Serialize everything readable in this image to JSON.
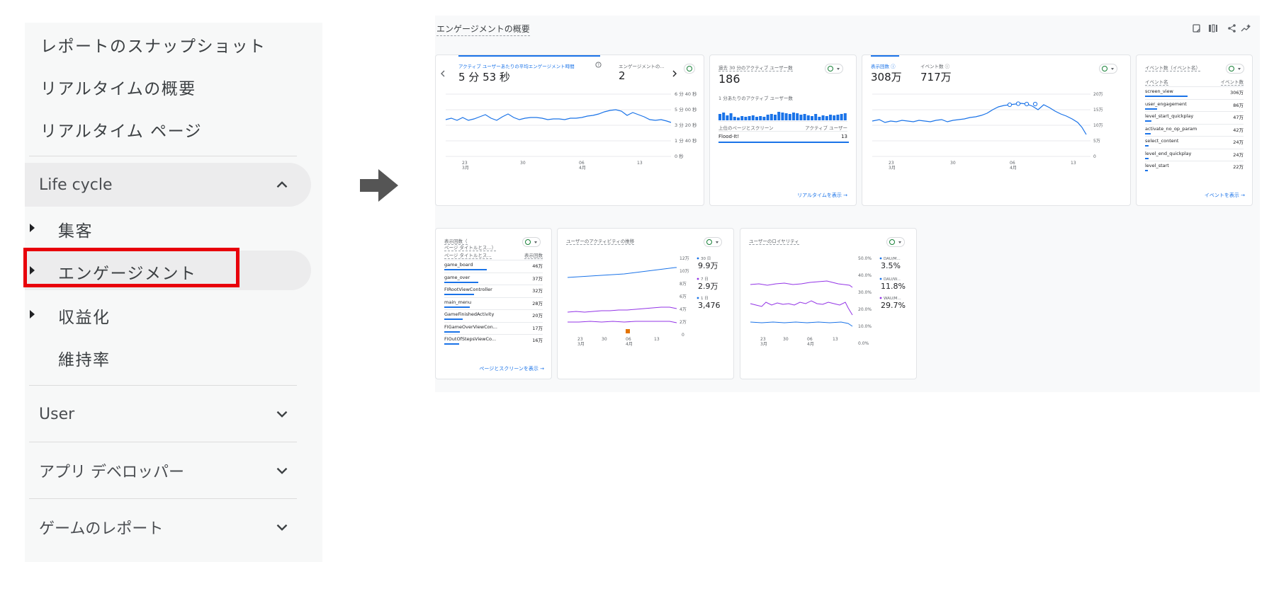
{
  "sidebar": {
    "top_items": [
      "レポートのスナップショット",
      "リアルタイムの概要",
      "リアルタイム ページ"
    ],
    "lifecycle": {
      "label": "Life cycle",
      "expanded": true
    },
    "sub_items": [
      {
        "label": "集客",
        "has_children": true
      },
      {
        "label": "エンゲージメント",
        "has_children": true,
        "highlighted": true
      },
      {
        "label": "収益化",
        "has_children": true
      },
      {
        "label": "維持率",
        "has_children": false
      }
    ],
    "groups": [
      {
        "label": "User",
        "expanded": false
      },
      {
        "label": "アプリ デベロッパー",
        "expanded": false
      },
      {
        "label": "ゲームのレポート",
        "expanded": false
      }
    ],
    "highlight_color": "#e8000b"
  },
  "dashboard": {
    "title": "エンゲージメントの概要",
    "top_icons": [
      "edit-report-icon",
      "compare-icon",
      "share-icon",
      "insights-icon"
    ],
    "card1": {
      "metric_label": "アクティブ ユーザーあたりの平均エンゲージメント時間",
      "metric_value": "5 分 53 秒",
      "metric2_label": "エンゲージメントの...",
      "metric2_value": "2",
      "y_ticks": [
        "6 分 40 秒",
        "5 分 00 秒",
        "3 分 20 秒",
        "1 分 40 秒",
        "0 秒"
      ],
      "x_ticks": [
        [
          "23",
          "3月"
        ],
        [
          "30",
          ""
        ],
        [
          "06",
          "4月"
        ],
        [
          "13",
          ""
        ]
      ]
    },
    "card2": {
      "header": "過去 30 分のアクティブ ユーザー数",
      "value": "186",
      "sub_header": "1 分あたりのアクティブ ユーザー数",
      "table_headers": [
        "上位のページとスクリーン",
        "アクティブ ユーザー"
      ],
      "row": {
        "name": "Flood-It!",
        "value": "13"
      },
      "link": "リアルタイムを表示"
    },
    "card3": {
      "metric1_label": "表示回数",
      "metric1_value": "308万",
      "metric2_label": "イベント数",
      "metric2_value": "717万",
      "y_ticks": [
        "20万",
        "15万",
        "10万",
        "5万",
        "0"
      ],
      "x_ticks": [
        [
          "23",
          "3月"
        ],
        [
          "30",
          ""
        ],
        [
          "06",
          "4月"
        ],
        [
          "13",
          ""
        ]
      ]
    },
    "card4": {
      "header": "イベント数（イベント名）",
      "col_headers": [
        "イベント名",
        "イベント数"
      ],
      "rows": [
        {
          "name": "screen_view",
          "value": "306万",
          "share": 1.0
        },
        {
          "name": "user_engagement",
          "value": "86万",
          "share": 0.28
        },
        {
          "name": "level_start_quickplay",
          "value": "47万",
          "share": 0.15
        },
        {
          "name": "activate_no_op_param",
          "value": "42万",
          "share": 0.14
        },
        {
          "name": "select_content",
          "value": "24万",
          "share": 0.08
        },
        {
          "name": "level_end_quickplay",
          "value": "24万",
          "share": 0.08
        },
        {
          "name": "level_start",
          "value": "22万",
          "share": 0.07
        }
      ],
      "link": "イベントを表示"
    },
    "card5": {
      "header_line1": "表示回数（",
      "header_line2": "ページ タイトルとス...）",
      "col_headers": [
        "ページ タイトルとス...",
        "表示回数"
      ],
      "rows": [
        {
          "name": "game_board",
          "value": "46万",
          "share": 1.0
        },
        {
          "name": "game_over",
          "value": "37万",
          "share": 0.8
        },
        {
          "name": "FIRootViewController",
          "value": "32万",
          "share": 0.7
        },
        {
          "name": "main_menu",
          "value": "28万",
          "share": 0.6
        },
        {
          "name": "GameFinishedActivity",
          "value": "20万",
          "share": 0.43
        },
        {
          "name": "FIGameOverViewCon...",
          "value": "17万",
          "share": 0.37
        },
        {
          "name": "FIOutOfStepsViewCo...",
          "value": "16万",
          "share": 0.35
        }
      ],
      "link": "ページとスクリーンを表示"
    },
    "card6": {
      "header": "ユーザーのアクティビティの推移",
      "y_ticks": [
        "12万",
        "10万",
        "8万",
        "6万",
        "4万",
        "2万",
        "0"
      ],
      "legend": [
        {
          "label": "30 日",
          "value": "9.9万",
          "color": "#1a73e8"
        },
        {
          "label": "7 日",
          "value": "2.9万",
          "color": "#9334e6"
        },
        {
          "label": "1 日",
          "value": "3,476",
          "color": "#1a73e8"
        }
      ],
      "x_ticks": [
        [
          "23",
          "3月"
        ],
        [
          "30",
          ""
        ],
        [
          "06",
          "4月"
        ],
        [
          "13",
          ""
        ]
      ]
    },
    "card7": {
      "header": "ユーザーのロイヤリティ",
      "y_ticks": [
        "50.0%",
        "40.0%",
        "30.0%",
        "20.0%",
        "10.0%",
        "0.0%"
      ],
      "legend": [
        {
          "label": "DAU/M...",
          "value": "3.5%",
          "color": "#1a73e8"
        },
        {
          "label": "DAU/W...",
          "value": "11.8%",
          "color": "#1a73e8"
        },
        {
          "label": "WAU/M...",
          "value": "29.7%",
          "color": "#9334e6"
        }
      ],
      "x_ticks": [
        [
          "23",
          "3月"
        ],
        [
          "30",
          ""
        ],
        [
          "06",
          "4月"
        ],
        [
          "13",
          ""
        ]
      ]
    }
  }
}
